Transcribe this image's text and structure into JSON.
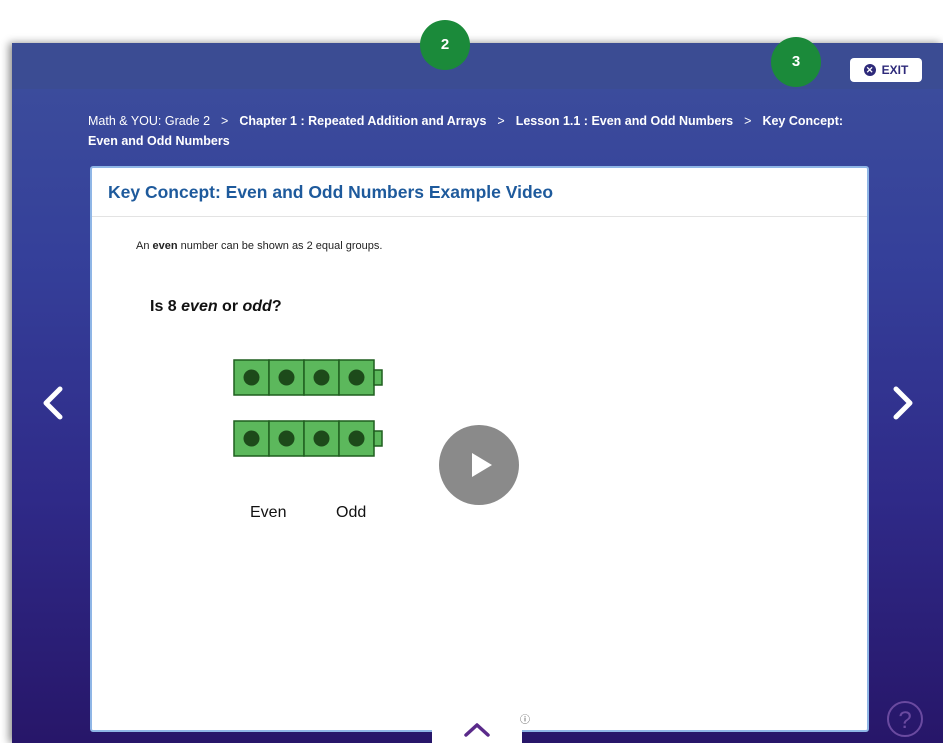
{
  "header": {
    "exit_label": "EXIT"
  },
  "breadcrumb": {
    "items": [
      "Math & YOU: Grade 2",
      "Chapter 1 : Repeated Addition and Arrays",
      "Lesson 1.1 : Even and Odd Numbers",
      "Key Concept: Even and Odd Numbers"
    ],
    "separator": ">"
  },
  "card": {
    "title": "Key Concept: Even and Odd Numbers Example Video"
  },
  "video": {
    "intro_before": "An ",
    "intro_bold": "even",
    "intro_after": " number can be shown as 2 equal groups.",
    "question_part1": "Is 8 ",
    "question_even": "even",
    "question_mid": " or ",
    "question_odd": "odd",
    "question_end": "?",
    "cube_rows": 2,
    "cubes_per_row": 4,
    "label_even": "Even",
    "label_odd": "Odd"
  },
  "help": {
    "symbol": "?"
  },
  "info": {
    "symbol": "ⓘ"
  },
  "annotations": {
    "marker_2": "2",
    "marker_3": "3"
  },
  "colors": {
    "background_top": "#3d4f9c",
    "background_bottom": "#271669",
    "card_border": "#8fb6e6",
    "title": "#1e5a9c",
    "cube_fill": "#5cb85c",
    "cube_dot": "#1d4a1a",
    "marker": "#1b8a3a"
  }
}
